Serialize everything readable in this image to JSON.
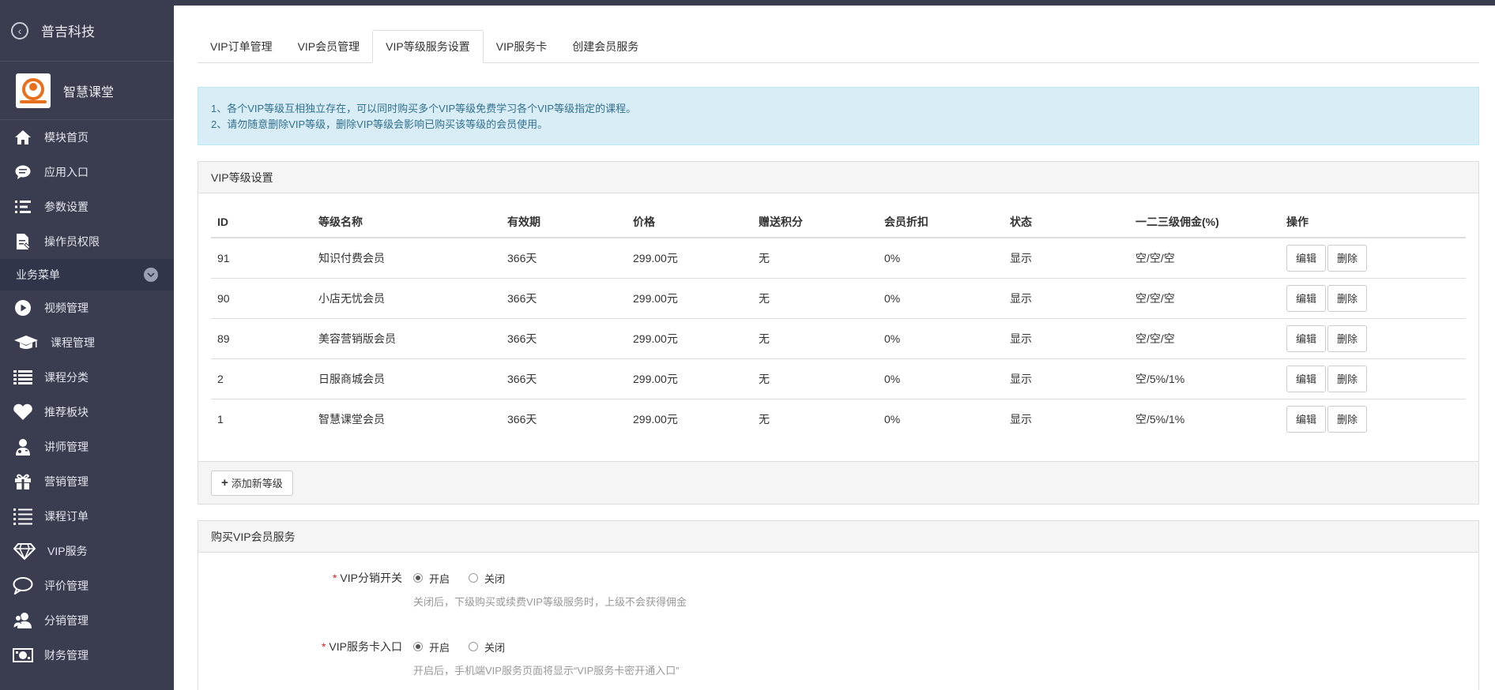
{
  "sidebar": {
    "brand": "普吉科技",
    "app_name": "智慧课堂",
    "top_items": [
      {
        "label": "模块首页",
        "icon": "home-icon"
      },
      {
        "label": "应用入口",
        "icon": "chat-icon"
      },
      {
        "label": "参数设置",
        "icon": "list-settings-icon"
      },
      {
        "label": "操作员权限",
        "icon": "document-edit-icon"
      }
    ],
    "group_label": "业务菜单",
    "group_items": [
      {
        "label": "视频管理",
        "icon": "play-icon"
      },
      {
        "label": "课程管理",
        "icon": "graduation-cap-icon"
      },
      {
        "label": "课程分类",
        "icon": "list-icon"
      },
      {
        "label": "推荐板块",
        "icon": "heart-icon"
      },
      {
        "label": "讲师管理",
        "icon": "user-md-icon"
      },
      {
        "label": "营销管理",
        "icon": "gift-icon"
      },
      {
        "label": "课程订单",
        "icon": "ordered-list-icon"
      },
      {
        "label": "VIP服务",
        "icon": "diamond-icon"
      },
      {
        "label": "评价管理",
        "icon": "comment-icon"
      },
      {
        "label": "分销管理",
        "icon": "users-icon"
      },
      {
        "label": "财务管理",
        "icon": "money-icon"
      }
    ]
  },
  "tabs": [
    {
      "label": "VIP订单管理",
      "active": false
    },
    {
      "label": "VIP会员管理",
      "active": false
    },
    {
      "label": "VIP等级服务设置",
      "active": true
    },
    {
      "label": "VIP服务卡",
      "active": false
    },
    {
      "label": "创建会员服务",
      "active": false
    }
  ],
  "alert": {
    "line1": "1、各个VIP等级互相独立存在，可以同时购买多个VIP等级免费学习各个VIP等级指定的课程。",
    "line2": "2、请勿随意删除VIP等级，删除VIP等级会影响已购买该等级的会员使用。"
  },
  "levels_panel": {
    "title": "VIP等级设置",
    "columns": [
      "ID",
      "等级名称",
      "有效期",
      "价格",
      "赠送积分",
      "会员折扣",
      "状态",
      "一二三级佣金(%)",
      "操作"
    ],
    "rows": [
      {
        "id": "91",
        "name": "知识付费会员",
        "validity": "366天",
        "price": "299.00元",
        "points": "无",
        "discount": "0%",
        "status": "显示",
        "commission": "空/空/空"
      },
      {
        "id": "90",
        "name": "小店无忧会员",
        "validity": "366天",
        "price": "299.00元",
        "points": "无",
        "discount": "0%",
        "status": "显示",
        "commission": "空/空/空"
      },
      {
        "id": "89",
        "name": "美容营销版会员",
        "validity": "366天",
        "price": "299.00元",
        "points": "无",
        "discount": "0%",
        "status": "显示",
        "commission": "空/空/空"
      },
      {
        "id": "2",
        "name": "日服商城会员",
        "validity": "366天",
        "price": "299.00元",
        "points": "无",
        "discount": "0%",
        "status": "显示",
        "commission": "空/5%/1%"
      },
      {
        "id": "1",
        "name": "智慧课堂会员",
        "validity": "366天",
        "price": "299.00元",
        "points": "无",
        "discount": "0%",
        "status": "显示",
        "commission": "空/5%/1%"
      }
    ],
    "edit_label": "编辑",
    "delete_label": "删除",
    "add_label": "添加新等级"
  },
  "buy_panel": {
    "title": "购买VIP会员服务",
    "fields": [
      {
        "label": "VIP分销开关",
        "on_label": "开启",
        "off_label": "关闭",
        "help": "关闭后，下级购买或续费VIP等级服务时，上级不会获得佣金"
      },
      {
        "label": "VIP服务卡入口",
        "on_label": "开启",
        "off_label": "关闭",
        "help": "开启后，手机端VIP服务页面将显示“VIP服务卡密开通入口”"
      }
    ]
  }
}
